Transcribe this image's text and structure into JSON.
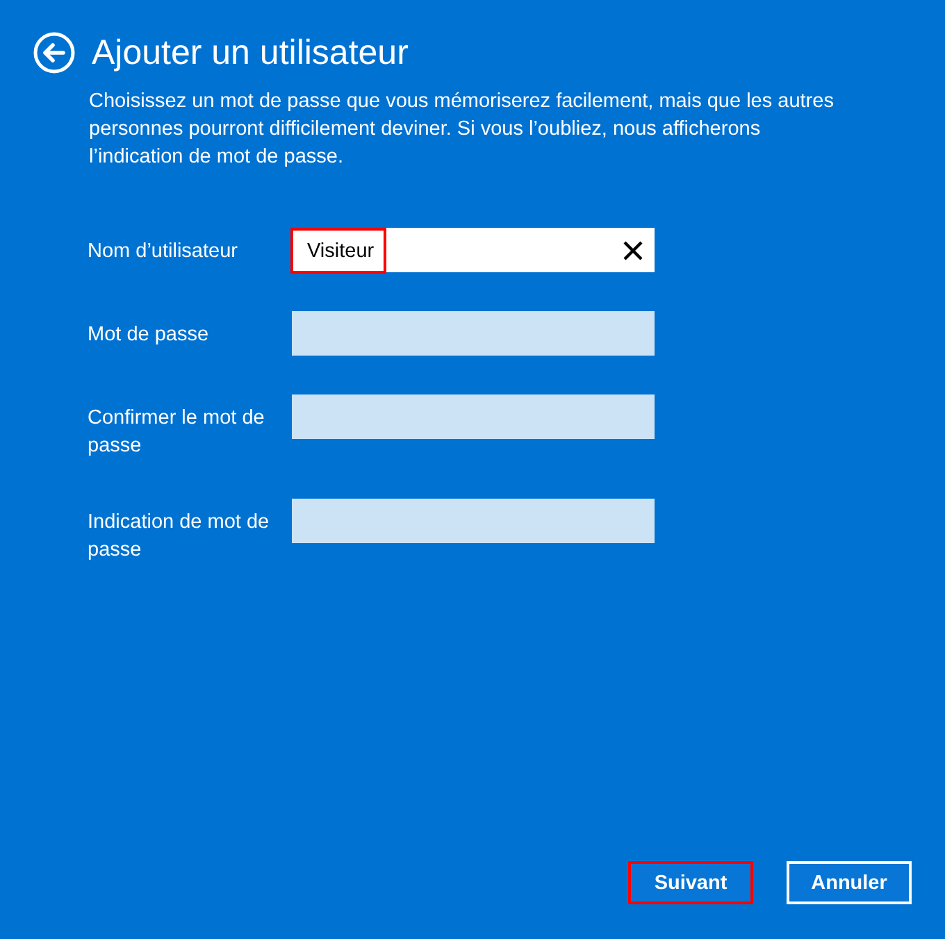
{
  "header": {
    "title": "Ajouter un utilisateur",
    "description": "Choisissez un mot de passe que vous mémoriserez facilement, mais que les autres personnes pourront difficilement deviner. Si vous l’oubliez, nous afficherons l’indication de mot de passe."
  },
  "fields": [
    {
      "label": "Nom d’utilisateur",
      "value": "Visiteur",
      "focused": true,
      "highlighted": true
    },
    {
      "label": "Mot de passe",
      "focused": false,
      "highlighted": false
    },
    {
      "label": "Confirmer le mot de passe",
      "focused": false,
      "highlighted": false
    },
    {
      "label": "Indication de mot de passe",
      "focused": false,
      "highlighted": false
    }
  ],
  "buttons": [
    {
      "label": "Suivant",
      "highlighted": true
    },
    {
      "label": "Annuler",
      "highlighted": false
    }
  ]
}
